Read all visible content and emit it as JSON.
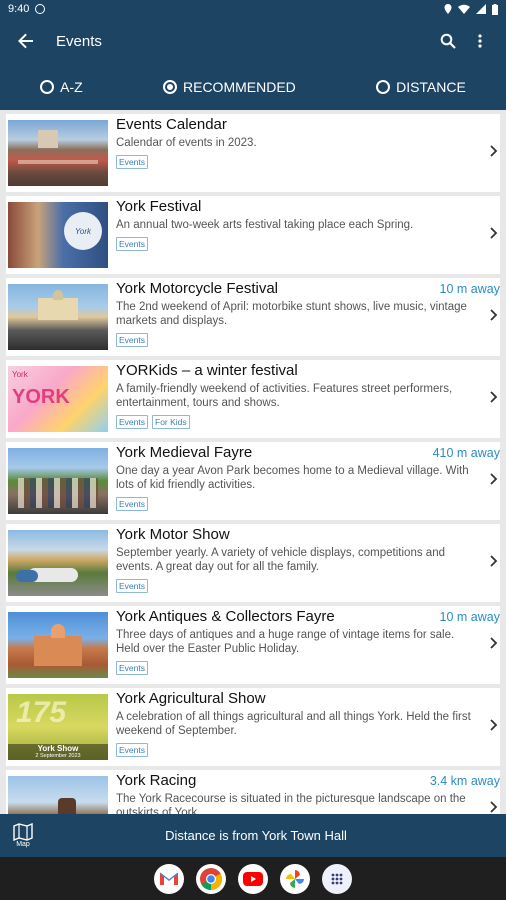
{
  "status": {
    "time": "9:40"
  },
  "app_bar": {
    "title": "Events",
    "back_icon": "arrow-back-icon",
    "search_icon": "search-icon",
    "menu_icon": "more-vert-icon"
  },
  "sort": {
    "options": [
      {
        "label": "A-Z",
        "selected": false
      },
      {
        "label": "RECOMMENDED",
        "selected": true
      },
      {
        "label": "DISTANCE",
        "selected": false
      }
    ]
  },
  "events": [
    {
      "title": "Events Calendar",
      "desc": "Calendar of events in 2023.",
      "tags": [
        "Events"
      ],
      "distance": ""
    },
    {
      "title": "York Festival",
      "desc": "An annual two-week arts festival taking place each Spring.",
      "tags": [
        "Events"
      ],
      "distance": ""
    },
    {
      "title": "York Motorcycle Festival",
      "desc": "The 2nd weekend of April: motorbike stunt shows, live music, vintage markets and displays.",
      "tags": [
        "Events"
      ],
      "distance": "10 m away"
    },
    {
      "title": "YORKids – a winter festival",
      "desc": "A family-friendly weekend of activities. Features street performers, entertainment, tours and shows.",
      "tags": [
        "Events",
        "For Kids"
      ],
      "distance": ""
    },
    {
      "title": "York Medieval Fayre",
      "desc": "One day a year Avon Park becomes home to a Medieval village. With lots of kid friendly activities.",
      "tags": [
        "Events"
      ],
      "distance": "410 m away"
    },
    {
      "title": "York Motor Show",
      "desc": "September yearly. A variety of vehicle displays, competitions and events. A great day out for all the family.",
      "tags": [
        "Events"
      ],
      "distance": ""
    },
    {
      "title": "York Antiques & Collectors Fayre",
      "desc": "Three days of antiques and a huge range of vintage items for sale. Held over the Easter Public Holiday.",
      "tags": [
        "Events"
      ],
      "distance": "10 m away"
    },
    {
      "title": "York Agricultural Show",
      "desc": "A celebration of all things agricultural and all things York. Held the first weekend of September.",
      "tags": [
        "Events"
      ],
      "distance": ""
    },
    {
      "title": "York Racing",
      "desc": "The York Racecourse is situated in the picturesque landscape on the outskirts of York.",
      "tags": [],
      "distance": "3.4 km away"
    }
  ],
  "bottom_bar": {
    "map_label": "Map",
    "text": "Distance is from York Town Hall"
  },
  "thumb_texts": {
    "festival": "York",
    "yorkids": "YORK",
    "yorkids_small": "York",
    "ag_number": "175",
    "ag_title": "York Show",
    "ag_date": "2 September 2023"
  },
  "colors": {
    "primary": "#1d4563",
    "accent": "#2b8cc4"
  }
}
